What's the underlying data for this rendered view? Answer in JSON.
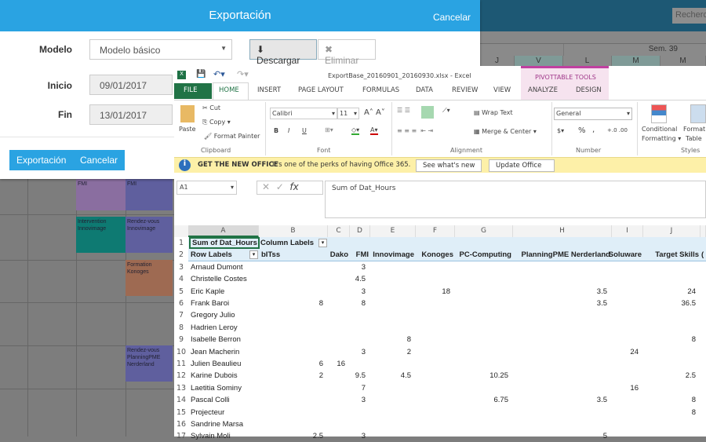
{
  "planner": {
    "search_placeholder": "Recherch",
    "week": "Sem. 39",
    "days": [
      "J",
      "V",
      "L",
      "M",
      "M"
    ],
    "events": [
      "FMI",
      "FMI",
      "Intervention Innovimage",
      "Rendez-vous Innovimage",
      "Formation Konoges",
      "Rendez-vous PlanningPME Nerderland"
    ],
    "colors": {
      "purple": "#8a6ea0",
      "blue": "#5f5f9e",
      "teal": "#0e7a72",
      "brown": "#9e6a52"
    }
  },
  "dialog": {
    "title": "Exportación",
    "cancel_top": "Cancelar",
    "model_label": "Modelo",
    "model_value": "Modelo básico",
    "download": "Descargar",
    "delete": "Eliminar",
    "start_label": "Inicio",
    "start_value": "09/01/2017",
    "end_label": "Fin",
    "end_value": "13/01/2017",
    "export_btn": "Exportación",
    "cancel_btn": "Cancelar",
    "accent": "#2aa3e2"
  },
  "excel": {
    "title": "ExportBase_20160901_20160930.xlsx - Excel",
    "pivot_tools": "PIVOTTABLE TOOLS",
    "tabs": [
      "FILE",
      "HOME",
      "INSERT",
      "PAGE LAYOUT",
      "FORMULAS",
      "DATA",
      "REVIEW",
      "VIEW",
      "ANALYZE",
      "DESIGN"
    ],
    "ribbon": {
      "paste": "Paste",
      "cut": "Cut",
      "copy": "Copy",
      "format_painter": "Format Painter",
      "clipboard": "Clipboard",
      "font_name": "Calibri",
      "font_size": "11",
      "bold": "B",
      "italic": "I",
      "underline": "U",
      "font": "Font",
      "wrap": "Wrap Text",
      "merge": "Merge & Center",
      "alignment": "Alignment",
      "number_format": "General",
      "percent": "%",
      "comma": ",",
      "number": "Number",
      "conditional": "Conditional",
      "formatting": "Formatting",
      "format_table1": "Format",
      "format_table2": "Table",
      "styles": "Styles"
    },
    "notice": {
      "title": "GET THE NEW OFFICE",
      "text": "It's one of the perks of having Office 365.",
      "btn1": "See what's new",
      "btn2": "Update Office"
    },
    "name_box": "A1",
    "formula": "Sum of Dat_Hours",
    "columns": [
      "A",
      "B",
      "C",
      "D",
      "E",
      "F",
      "G",
      "H",
      "I",
      "J"
    ],
    "a1": "Sum of Dat_Hours",
    "b1": "Column Labels",
    "a2": "Row Labels",
    "col_labels": [
      "bITss",
      "Dako",
      "FMI",
      "Innovimage",
      "Konoges",
      "PC-Computing",
      "PlanningPME Nerderland",
      "Soluware",
      "Target Skills",
      "("
    ],
    "rows": [
      {
        "n": "3",
        "name": "Arnaud Dumont",
        "v": {
          "D": "3"
        }
      },
      {
        "n": "4",
        "name": "Christelle Costes",
        "v": {
          "D": "4.5"
        }
      },
      {
        "n": "5",
        "name": "Eric Kaple",
        "v": {
          "D": "3",
          "F": "18",
          "H": "3.5",
          "J": "24"
        }
      },
      {
        "n": "6",
        "name": "Frank Baroi",
        "v": {
          "B": "8",
          "D": "8",
          "H": "3.5",
          "J": "36.5"
        }
      },
      {
        "n": "7",
        "name": "Gregory Julio",
        "v": {}
      },
      {
        "n": "8",
        "name": "Hadrien Leroy",
        "v": {}
      },
      {
        "n": "9",
        "name": "Isabelle Berron",
        "v": {
          "E": "8",
          "J": "8"
        }
      },
      {
        "n": "10",
        "name": "Jean Macherin",
        "v": {
          "D": "3",
          "E": "2",
          "I": "24"
        }
      },
      {
        "n": "11",
        "name": "Julien Beaulieu",
        "v": {
          "B": "6",
          "C": "16"
        }
      },
      {
        "n": "12",
        "name": "Karine Dubois",
        "v": {
          "B": "2",
          "D": "9.5",
          "E": "4.5",
          "G": "10.25",
          "J": "2.5"
        }
      },
      {
        "n": "13",
        "name": "Laetitia Sominy",
        "v": {
          "D": "7",
          "I": "16"
        }
      },
      {
        "n": "14",
        "name": "Pascal Colli",
        "v": {
          "D": "3",
          "G": "6.75",
          "H": "3.5",
          "J": "8"
        }
      },
      {
        "n": "15",
        "name": "Projecteur",
        "v": {
          "J": "8"
        }
      },
      {
        "n": "16",
        "name": "Sandrine Marsa",
        "v": {}
      },
      {
        "n": "17",
        "name": "Sylvain Moli",
        "v": {
          "B": "2.5",
          "D": "3",
          "H": "5"
        }
      }
    ]
  }
}
